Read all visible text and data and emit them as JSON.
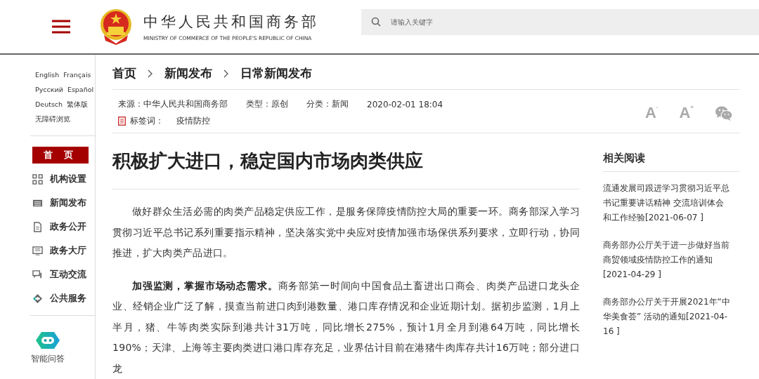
{
  "header": {
    "title": "中华人民共和国商务部",
    "subtitle": "MINISTRY OF COMMERCE OF THE PEOPLE'S REPUBLIC OF CHINA",
    "search": {
      "placeholder": "请输入关键字"
    }
  },
  "sidebar": {
    "languages": [
      [
        "English",
        "Français"
      ],
      [
        "Русский",
        "Español"
      ],
      [
        "Deutsch",
        "繁体版"
      ],
      [
        "无障碍浏览"
      ]
    ],
    "items": [
      {
        "label": "首 页",
        "kind": "home",
        "selected": true
      },
      {
        "label": "机构设置",
        "kind": "grid",
        "selected": false
      },
      {
        "label": "新闻发布",
        "kind": "news",
        "selected": false
      },
      {
        "label": "政务公开",
        "kind": "doc",
        "selected": false
      },
      {
        "label": "政务大厅",
        "kind": "screen",
        "selected": false
      },
      {
        "label": "互动交流",
        "kind": "chat",
        "selected": false
      },
      {
        "label": "公共服务",
        "kind": "service",
        "selected": false
      }
    ],
    "assistant": "智能问答"
  },
  "breadcrumb": [
    "首页",
    "新闻发布",
    "日常新闻发布"
  ],
  "meta": {
    "source": "来源：中华人民共和国商务部",
    "type": "类型：原创",
    "category": "分类：新闻",
    "date": "2020-02-01 18:04",
    "tag_label": "标签词：",
    "tag": "疫情防控"
  },
  "font_buttons": [
    {
      "label": "A",
      "sign": "-"
    },
    {
      "label": "A",
      "sign": "+"
    }
  ],
  "article": {
    "title": "积极扩大进口，稳定国内市场肉类供应",
    "paragraphs": [
      "做好群众生活必需的肉类产品稳定供应工作，是服务保障疫情防控大局的重要一环。商务部深入学习贯彻习近平总书记系列重要指示精神，坚决落实党中央应对疫情加强市场保供系列要求，立即行动，协同推进，扩大肉类产品进口。",
      "**加强监测，掌握市场动态需求。**商务部第一时间向中国食品土畜进出口商会、肉类产品进口龙头企业、经销企业广泛了解，摸查当前进口肉到港数量、港口库存情况和企业近期计划。据初步监测，1月上半月，猪、牛等肉类实际到港共计31万吨，同比增长275%，预计1月全月到港64万吨，同比增长190%；天津、上海等主要肉类进口港口库存充足，业界估计目前在港猪牛肉库存共计16万吨；部分进口龙"
    ]
  },
  "related": {
    "title": "相关阅读",
    "items": [
      "流通发展司跟进学习贯彻习近平总书记重要讲话精神 交流培训体会和工作经验[2021-06-07 ]",
      "商务部办公厅关于进一步做好当前商贸领域疫情防控工作的通知[2021-04-29 ]",
      "商务部办公厅关于开展2021年“中华美食荟” 活动的通知[2021-04-16 ]"
    ]
  }
}
